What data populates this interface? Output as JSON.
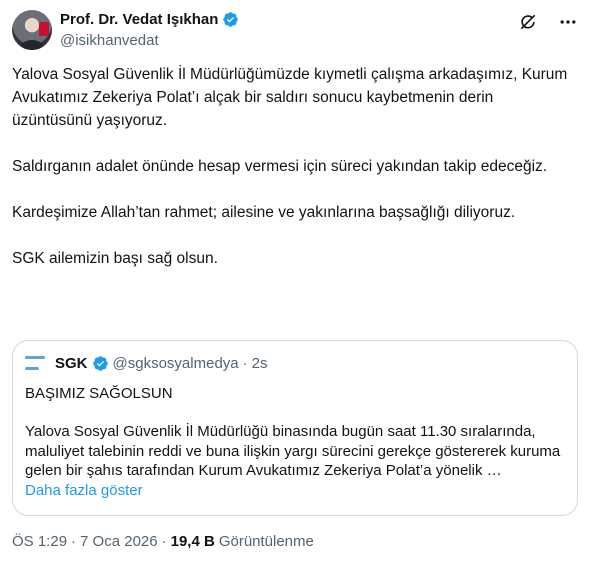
{
  "author": {
    "name": "Prof. Dr. Vedat Işıkhan",
    "handle": "@isikhanvedat"
  },
  "colors": {
    "verified": "#1d9bf0",
    "link": "#1d9bf0",
    "muted": "#536471",
    "text": "#0f1419",
    "border": "#cfd9de"
  },
  "icons": {
    "grok": "grok-icon",
    "more": "more-icon"
  },
  "tweet": {
    "paragraphs": [
      "Yalova Sosyal Güvenlik İl Müdürlüğümüzde kıymetli çalışma arkadaşımız, Kurum Avukatımız Zekeriya Polat’ı alçak bir saldırı sonucu kaybetmenin derin üzüntüsünü yaşıyoruz.",
      "Saldırganın adalet önünde hesap vermesi için süreci yakından takip edeceğiz.",
      "Kardeşimize Allah’tan rahmet; ailesine ve yakınlarına başsağlığı diliyoruz.",
      "SGK ailemizin başı sağ olsun."
    ]
  },
  "quote": {
    "name": "SGK",
    "handle": "@sgksosyalmedya",
    "separator": "·",
    "time": "2s",
    "title": "BAŞIMIZ SAĞOLSUN",
    "body": "Yalova Sosyal Güvenlik İl Müdürlüğü binasında bugün saat 11.30 sıralarında, maluliyet talebinin reddi ve buna ilişkin yargı sürecini gerekçe göstererek kuruma gelen bir şahıs tarafından Kurum Avukatımız Zekeriya Polat’a yönelik …",
    "show_more": "Daha fazla göster"
  },
  "meta": {
    "time": "ÖS 1:29",
    "separator1": "·",
    "date": "7 Oca 2026",
    "separator2": "·",
    "views_count": "19,4 B",
    "views_label": "Görüntülenme"
  }
}
